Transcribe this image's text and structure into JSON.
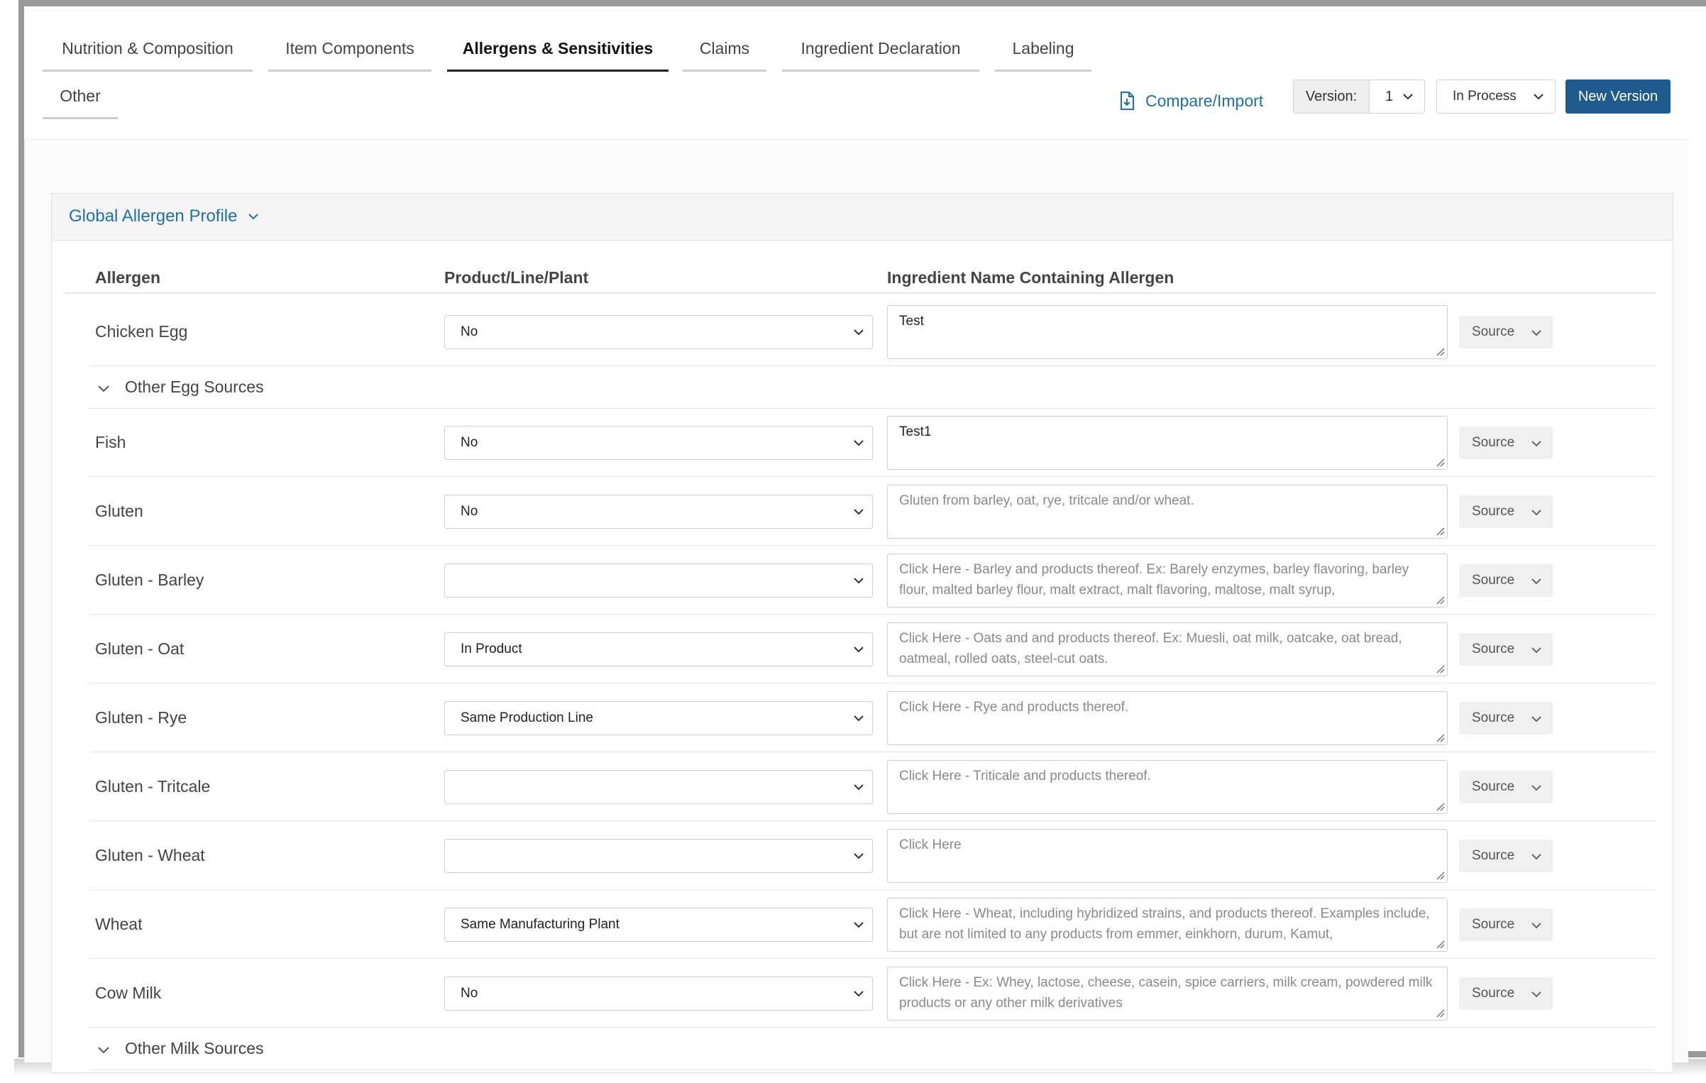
{
  "tabs": [
    {
      "label": "Nutrition & Composition",
      "active": false
    },
    {
      "label": "Item Components",
      "active": false
    },
    {
      "label": "Allergens & Sensitivities",
      "active": true
    },
    {
      "label": "Claims",
      "active": false
    },
    {
      "label": "Ingredient Declaration",
      "active": false
    },
    {
      "label": "Labeling",
      "active": false
    },
    {
      "label": "Other",
      "active": false
    }
  ],
  "toolbar": {
    "compare_label": "Compare/Import",
    "version_label": "Version:",
    "version_value": "1",
    "status_value": "In Process",
    "new_version_label": "New Version"
  },
  "section": {
    "title": "Global Allergen Profile",
    "columns": {
      "allergen": "Allergen",
      "product": "Product/Line/Plant",
      "ingredient": "Ingredient Name Containing Allergen"
    }
  },
  "rows": [
    {
      "allergen": "Chicken Egg",
      "product": "No",
      "ingredient_value": "Test",
      "ingredient_placeholder": "",
      "source": "Source"
    },
    {
      "allergen": "Fish",
      "product": "No",
      "ingredient_value": "Test1",
      "ingredient_placeholder": "",
      "source": "Source"
    },
    {
      "allergen": "Gluten",
      "product": "No",
      "ingredient_value": "",
      "ingredient_placeholder": "Gluten from barley, oat, rye, tritcale and/or wheat.",
      "source": "Source"
    },
    {
      "allergen": "Gluten - Barley",
      "product": "",
      "ingredient_value": "",
      "ingredient_placeholder": "Click Here - Barley and products thereof. Ex: Barely enzymes, barley flavoring, barley flour, malted barley flour, malt extract, malt flavoring, maltose, malt syrup,",
      "source": "Source"
    },
    {
      "allergen": "Gluten - Oat",
      "product": "In Product",
      "ingredient_value": "",
      "ingredient_placeholder": "Click Here - Oats and and products thereof. Ex: Muesli, oat milk, oatcake, oat bread, oatmeal, rolled oats, steel-cut oats.",
      "source": "Source"
    },
    {
      "allergen": "Gluten - Rye",
      "product": "Same Production Line",
      "ingredient_value": "",
      "ingredient_placeholder": "Click Here - Rye and products thereof.",
      "source": "Source"
    },
    {
      "allergen": "Gluten - Tritcale",
      "product": "",
      "ingredient_value": "",
      "ingredient_placeholder": "Click Here - Triticale and products thereof.",
      "source": "Source"
    },
    {
      "allergen": "Gluten - Wheat",
      "product": "",
      "ingredient_value": "",
      "ingredient_placeholder": "Click Here",
      "source": "Source"
    },
    {
      "allergen": "Wheat",
      "product": "Same Manufacturing Plant",
      "ingredient_value": "",
      "ingredient_placeholder": "Click Here - Wheat, including hybridized strains, and products thereof. Examples include, but are not limited to any products from emmer, einkhorn, durum, Kamut,",
      "source": "Source"
    },
    {
      "allergen": "Cow Milk",
      "product": "No",
      "ingredient_value": "",
      "ingredient_placeholder": "Click Here - Ex: Whey, lactose, cheese, casein, spice carriers, milk cream, powdered milk products or any other milk derivatives",
      "source": "Source"
    }
  ],
  "groups": {
    "egg": "Other Egg Sources",
    "milk": "Other Milk Sources"
  }
}
